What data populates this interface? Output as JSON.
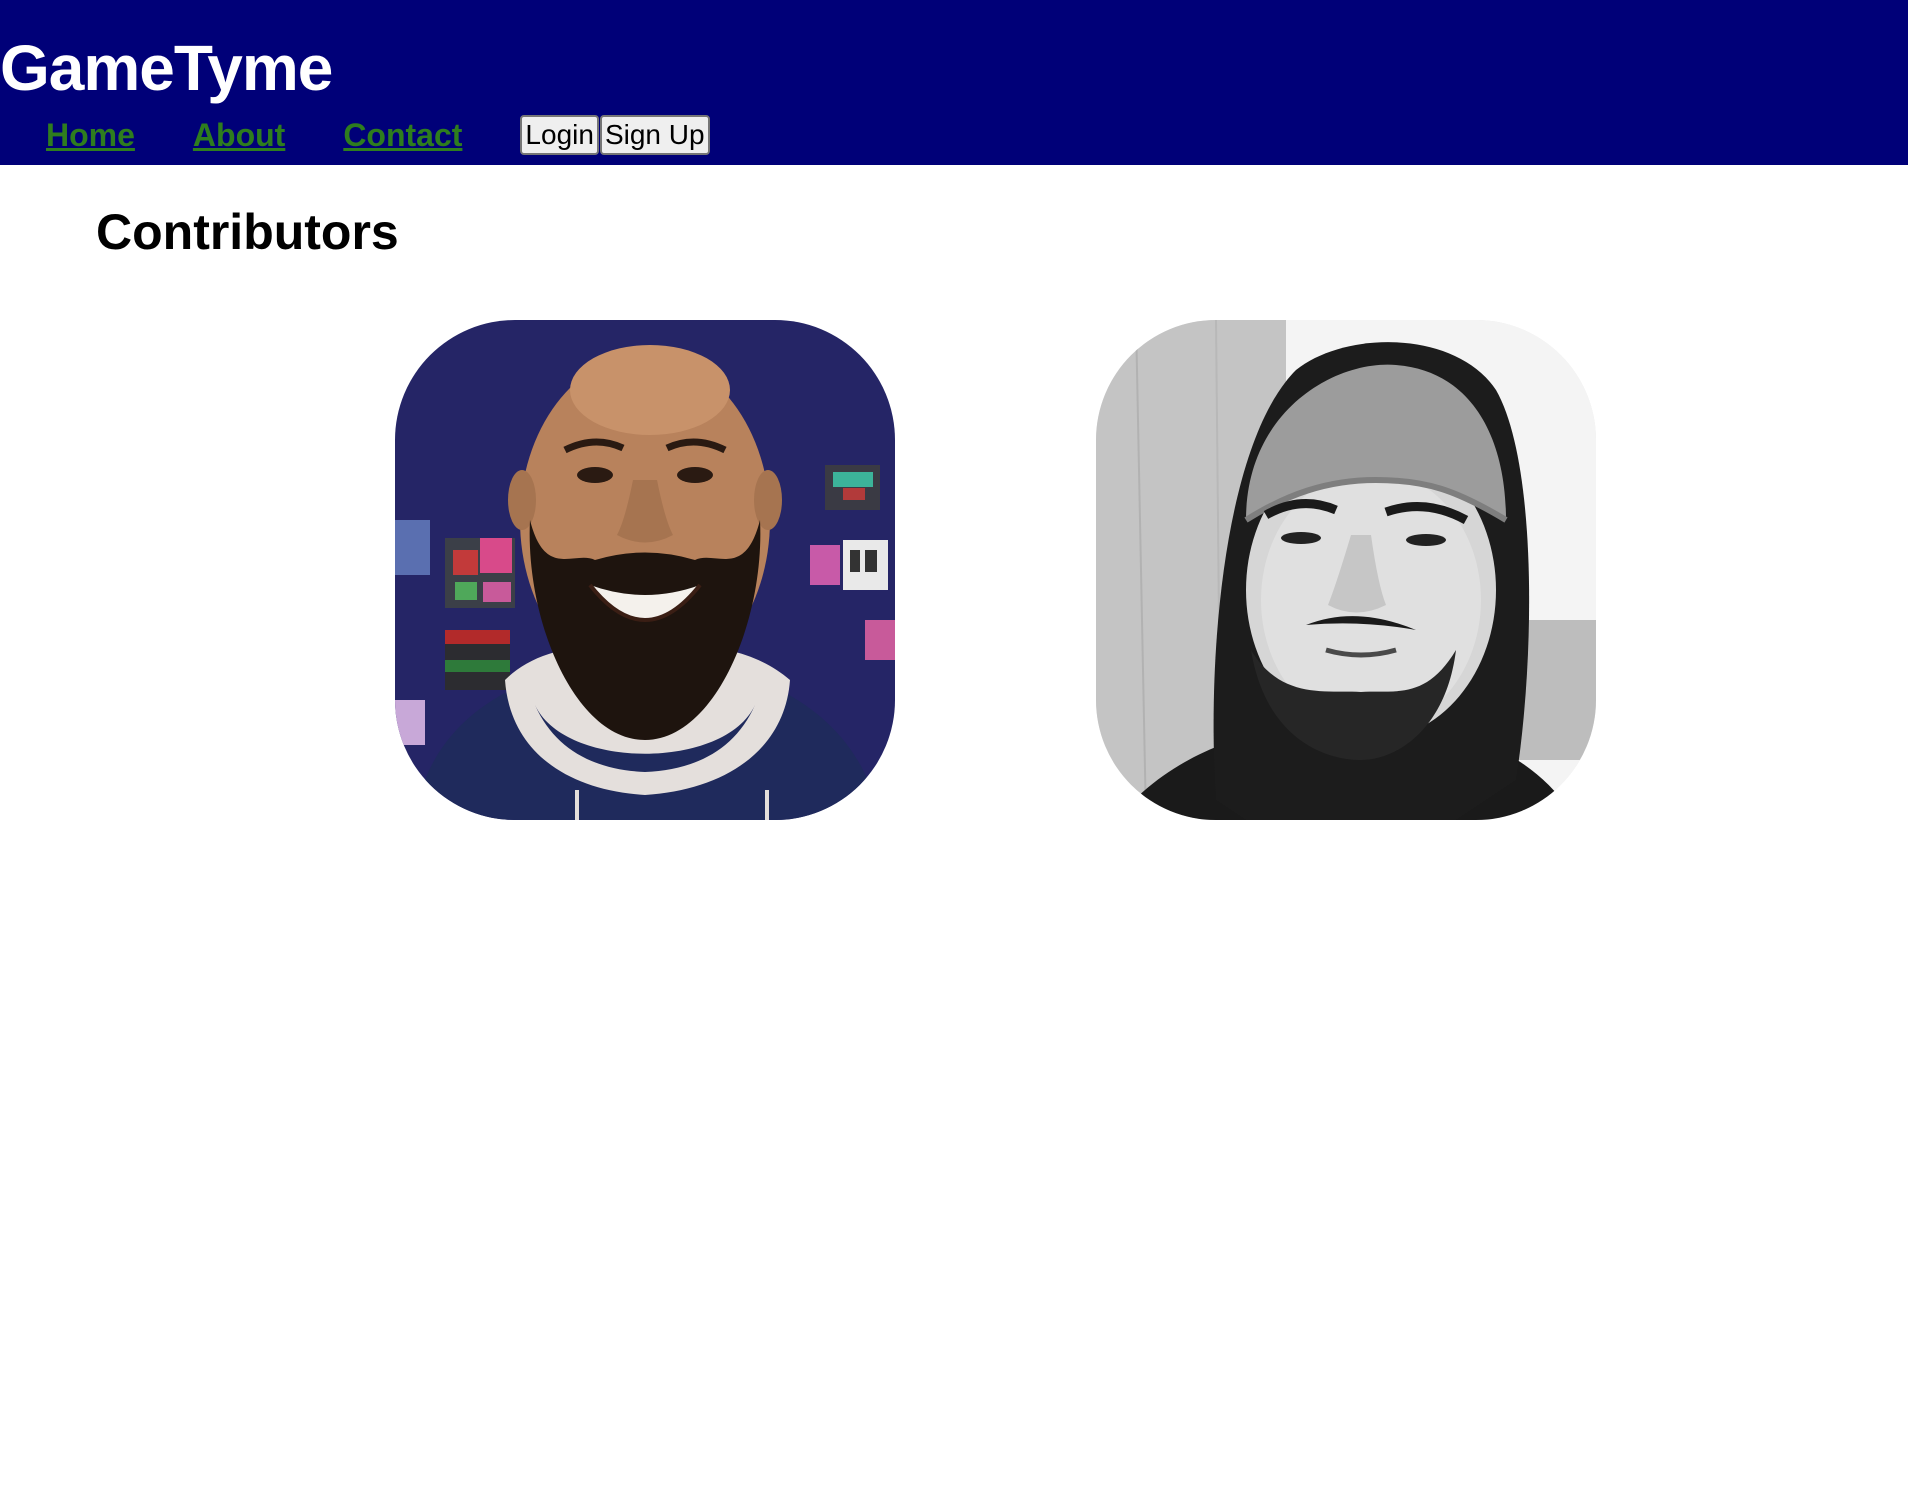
{
  "header": {
    "brand": "GameTyme",
    "nav": [
      {
        "label": "Home"
      },
      {
        "label": "About"
      },
      {
        "label": "Contact"
      }
    ],
    "login_label": "Login",
    "signup_label": "Sign Up",
    "colors": {
      "header_bg": "#000078",
      "link": "#2e7d1e",
      "brand_text": "#ffffff"
    }
  },
  "main": {
    "title": "Contributors",
    "contributors": [
      {
        "photo": "contributor-photo-smiling-bearded-man",
        "tone": "color"
      },
      {
        "photo": "contributor-photo-man-in-beanie-hood",
        "tone": "grayscale"
      }
    ]
  }
}
